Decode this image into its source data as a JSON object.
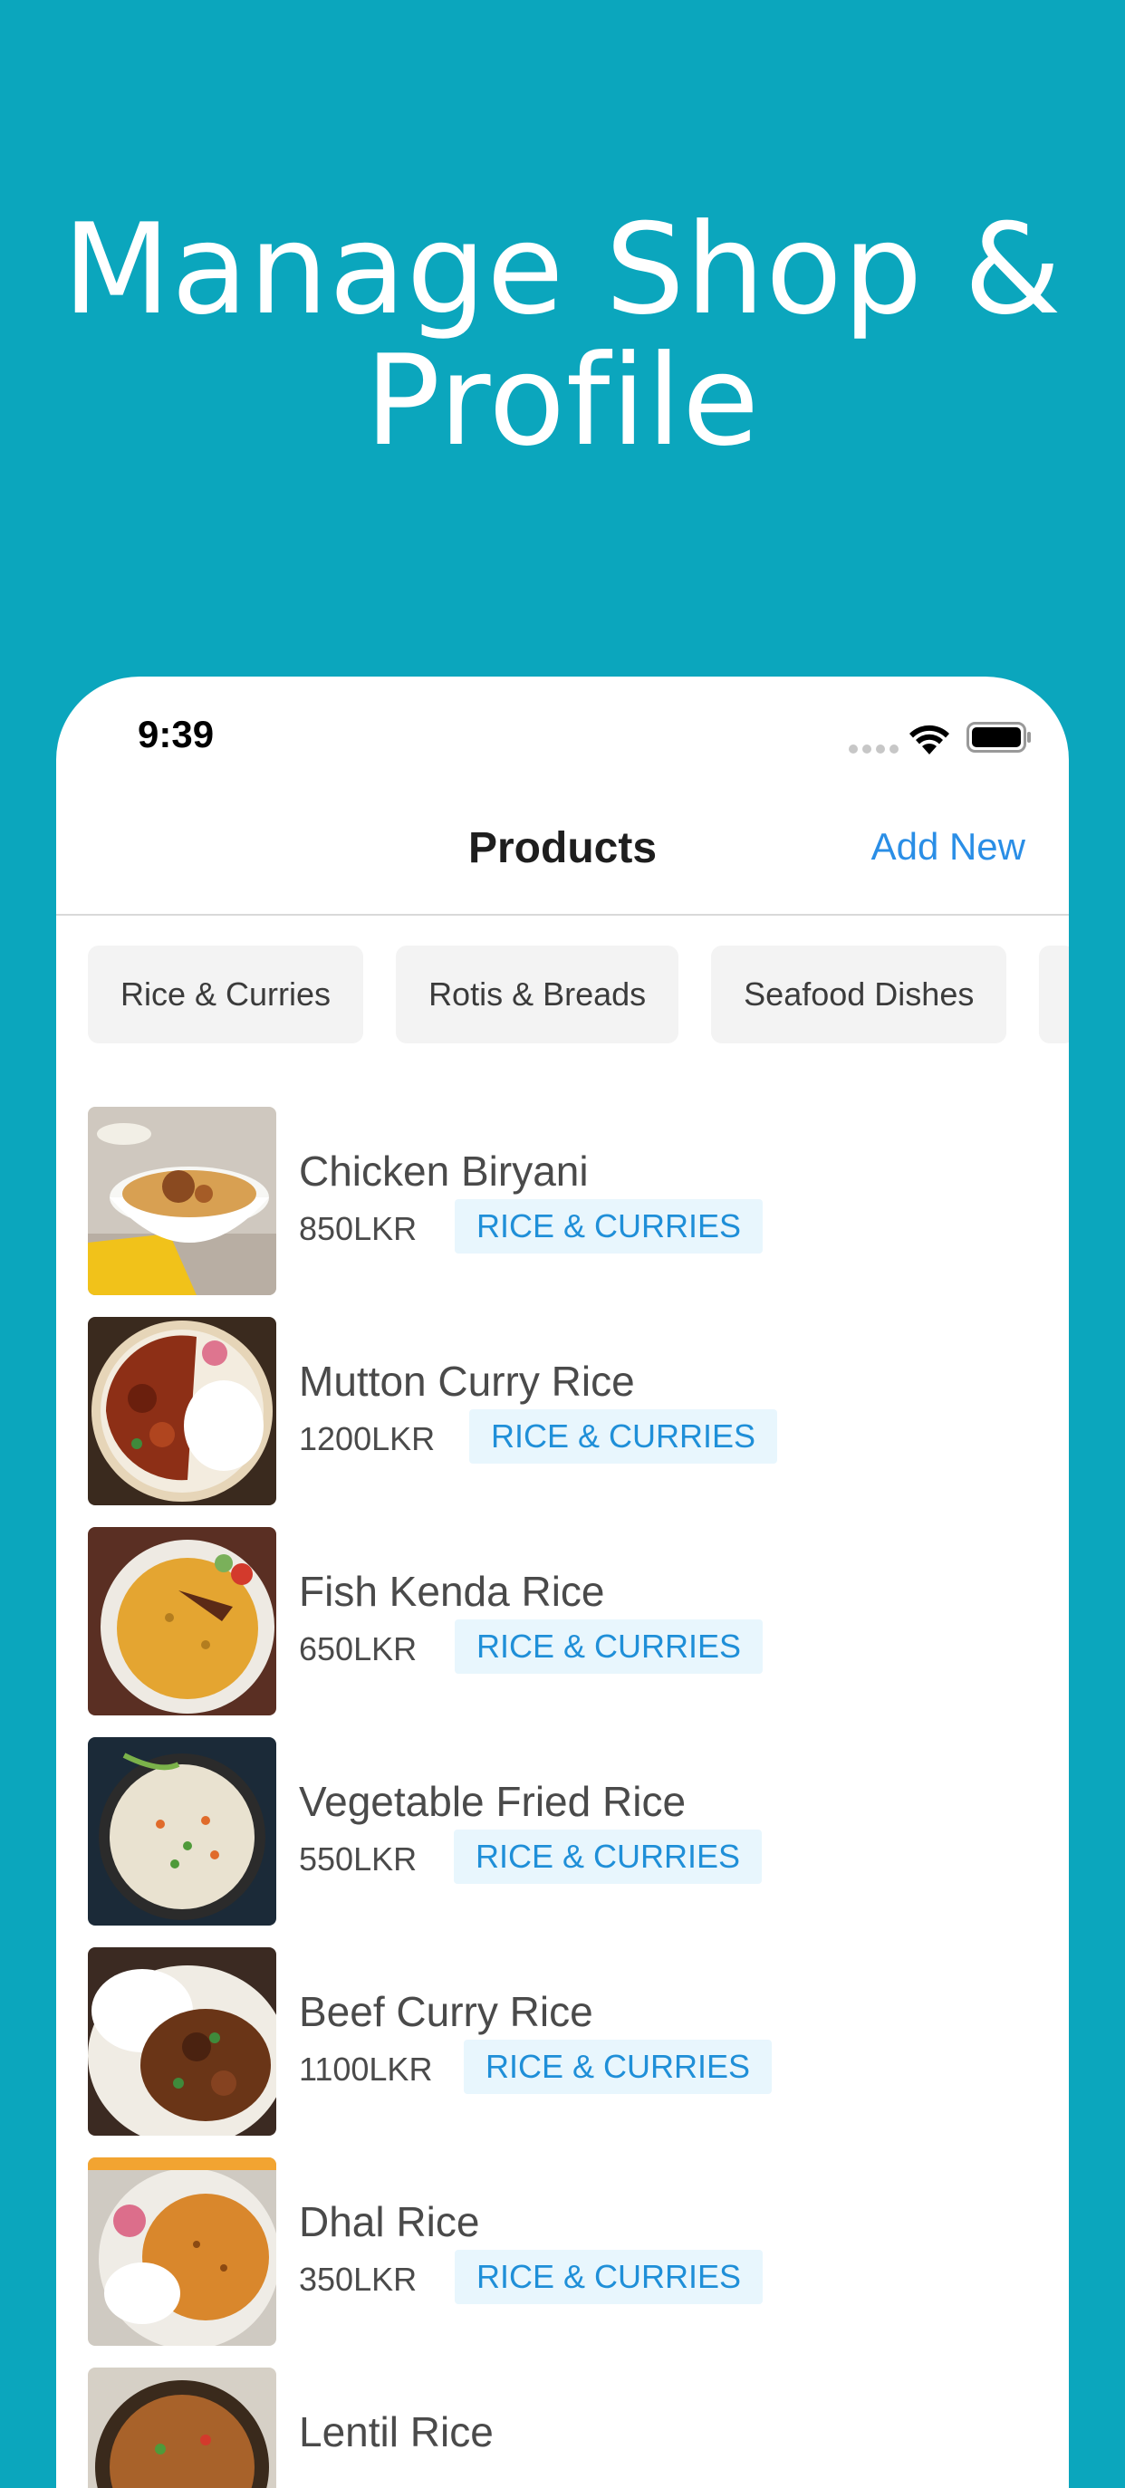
{
  "headline": {
    "line1": "Manage Shop &",
    "line2": "Profile"
  },
  "status_bar": {
    "time": "9:39"
  },
  "nav": {
    "title": "Products",
    "action": "Add New"
  },
  "categories": [
    "Rice & Curries",
    "Rotis & Breads",
    "Seafood Dishes"
  ],
  "products": [
    {
      "name": "Chicken Biryani",
      "price": "850LKR",
      "tag": "RICE & CURRIES"
    },
    {
      "name": "Mutton Curry Rice",
      "price": "1200LKR",
      "tag": "RICE & CURRIES"
    },
    {
      "name": "Fish Kenda Rice",
      "price": "650LKR",
      "tag": "RICE & CURRIES"
    },
    {
      "name": "Vegetable Fried Rice",
      "price": "550LKR",
      "tag": "RICE & CURRIES"
    },
    {
      "name": "Beef Curry Rice",
      "price": "1100LKR",
      "tag": "RICE & CURRIES"
    },
    {
      "name": "Dhal Rice",
      "price": "350LKR",
      "tag": "RICE & CURRIES"
    },
    {
      "name": "Lentil Rice",
      "price": "",
      "tag": ""
    }
  ],
  "colors": {
    "background": "#0ba6bd",
    "accent": "#2a8ee6",
    "tag_bg": "#e8f6fd",
    "tag_text": "#1f8fd8"
  }
}
